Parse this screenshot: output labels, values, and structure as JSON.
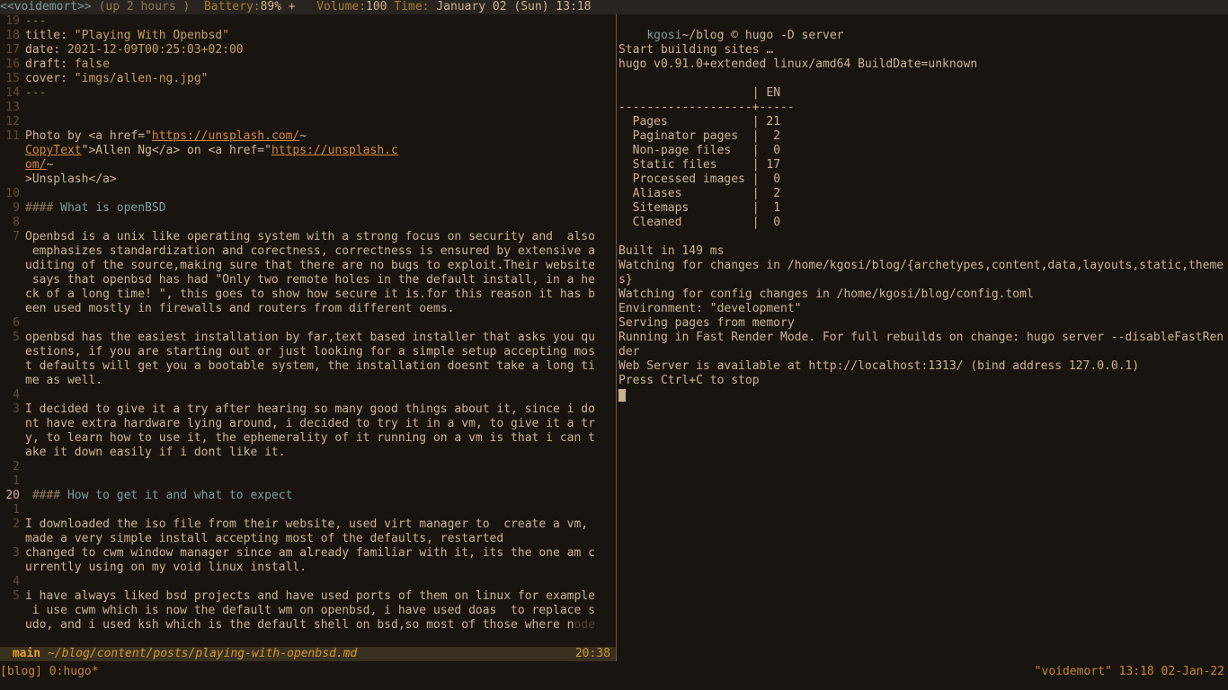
{
  "topbar": {
    "host": "<<voidemort>>",
    "uptime": " (up 2 hours )  ",
    "bat_label": "Battery:",
    "bat_value": "89% +   ",
    "vol_label": "Volume:",
    "vol_value": "100 ",
    "time_label": "Time: ",
    "time_value": "January 02 (Sun) 13:18"
  },
  "editor": {
    "lines": [
      {
        "n": "19",
        "segs": [
          {
            "c": "punct",
            "t": "---"
          }
        ]
      },
      {
        "n": "18",
        "segs": [
          {
            "c": "key",
            "t": "title: "
          },
          {
            "c": "str",
            "t": "\"Playing With Openbsd\""
          }
        ]
      },
      {
        "n": "17",
        "segs": [
          {
            "c": "key",
            "t": "date: "
          },
          {
            "c": "str",
            "t": "2021-12-09T00:25:03+02:00"
          }
        ]
      },
      {
        "n": "16",
        "segs": [
          {
            "c": "key",
            "t": "draft: "
          },
          {
            "c": "str",
            "t": "false"
          }
        ]
      },
      {
        "n": "15",
        "segs": [
          {
            "c": "key",
            "t": "cover: "
          },
          {
            "c": "str",
            "t": "\"imgs/allen-ng.jpg\""
          }
        ]
      },
      {
        "n": "14",
        "segs": [
          {
            "c": "punct",
            "t": "---"
          }
        ]
      },
      {
        "n": "13",
        "segs": [
          {
            "c": "txt",
            "t": ""
          }
        ]
      },
      {
        "n": "12",
        "segs": [
          {
            "c": "txt",
            "t": ""
          }
        ]
      },
      {
        "n": "11",
        "segs": [
          {
            "c": "txt",
            "t": "Photo by <a href=\""
          },
          {
            "c": "link",
            "t": "https://unsplash.com/"
          },
          {
            "c": "txt",
            "t": "~"
          }
        ]
      },
      {
        "n": "",
        "segs": [
          {
            "c": "link",
            "t": "CopyText"
          },
          {
            "c": "txt",
            "t": "\">Allen Ng</a> on <a href=\""
          },
          {
            "c": "link",
            "t": "https://unsplash.c"
          }
        ]
      },
      {
        "n": "",
        "segs": [
          {
            "c": "link",
            "t": "om/"
          },
          {
            "c": "txt",
            "t": "~"
          }
        ]
      },
      {
        "n": "",
        "segs": [
          {
            "c": "txt",
            "t": ">Unsplash</a>"
          }
        ]
      },
      {
        "n": "10",
        "segs": [
          {
            "c": "txt",
            "t": ""
          }
        ]
      },
      {
        "n": "9",
        "segs": [
          {
            "c": "punct",
            "t": "#### "
          },
          {
            "c": "heading",
            "t": "What is openBSD"
          }
        ]
      },
      {
        "n": "8",
        "segs": [
          {
            "c": "txt",
            "t": ""
          }
        ]
      },
      {
        "n": "7",
        "segs": [
          {
            "c": "txt",
            "t": "Openbsd is a unix like operating system with a strong focus on security and  also"
          }
        ]
      },
      {
        "n": "",
        "segs": [
          {
            "c": "txt",
            "t": " emphasizes standardization and corectness, correctness is ensured by extensive a"
          }
        ]
      },
      {
        "n": "",
        "segs": [
          {
            "c": "txt",
            "t": "uditing of the source,making sure that there are no bugs to exploit.Their website"
          }
        ]
      },
      {
        "n": "",
        "segs": [
          {
            "c": "txt",
            "t": " says that openbsd has had \"Only two remote holes in the default install, in a he"
          }
        ]
      },
      {
        "n": "",
        "segs": [
          {
            "c": "txt",
            "t": "ck of a long time! \", this goes to show how secure it is.for this reason it has b"
          }
        ]
      },
      {
        "n": "",
        "segs": [
          {
            "c": "txt",
            "t": "een used mostly in firewalls and routers from different oems."
          }
        ]
      },
      {
        "n": "6",
        "segs": [
          {
            "c": "txt",
            "t": ""
          }
        ]
      },
      {
        "n": "5",
        "segs": [
          {
            "c": "txt",
            "t": "openbsd has the easiest installation by far,text based installer that asks you qu"
          }
        ]
      },
      {
        "n": "",
        "segs": [
          {
            "c": "txt",
            "t": "estions, if you are starting out or just looking for a simple setup accepting mos"
          }
        ]
      },
      {
        "n": "",
        "segs": [
          {
            "c": "txt",
            "t": "t defaults will get you a bootable system, the installation doesnt take a long ti"
          }
        ]
      },
      {
        "n": "",
        "segs": [
          {
            "c": "txt",
            "t": "me as well."
          }
        ]
      },
      {
        "n": "4",
        "segs": [
          {
            "c": "txt",
            "t": ""
          }
        ]
      },
      {
        "n": "3",
        "segs": [
          {
            "c": "txt",
            "t": "I decided to give it a try after hearing so many good things about it, since i do"
          }
        ]
      },
      {
        "n": "",
        "segs": [
          {
            "c": "txt",
            "t": "nt have extra hardware lying around, i decided to try it in a vm, to give it a tr"
          }
        ]
      },
      {
        "n": "",
        "segs": [
          {
            "c": "txt",
            "t": "y, to learn how to use it, the ephemerality of it running on a vm is that i can t"
          }
        ]
      },
      {
        "n": "",
        "segs": [
          {
            "c": "txt",
            "t": "ake it down easily if i dont like it."
          }
        ]
      },
      {
        "n": "2",
        "segs": [
          {
            "c": "txt",
            "t": ""
          }
        ]
      },
      {
        "n": "1",
        "segs": [
          {
            "c": "txt",
            "t": ""
          }
        ]
      },
      {
        "n": "20",
        "segs": [
          {
            "c": "txt",
            "t": " "
          },
          {
            "c": "punct",
            "t": "#### "
          },
          {
            "c": "heading",
            "t": "How to get it and what to expect"
          }
        ],
        "cur": true
      },
      {
        "n": "1",
        "segs": [
          {
            "c": "txt",
            "t": ""
          }
        ]
      },
      {
        "n": "2",
        "segs": [
          {
            "c": "txt",
            "t": "I downloaded the iso file from their website, used virt manager to  create a vm, "
          }
        ]
      },
      {
        "n": "",
        "segs": [
          {
            "c": "txt",
            "t": "made a very simple install accepting most of the defaults, restarted"
          }
        ]
      },
      {
        "n": "3",
        "segs": [
          {
            "c": "txt",
            "t": "changed to cwm window manager since am already familiar with it, its the one am c"
          }
        ]
      },
      {
        "n": "",
        "segs": [
          {
            "c": "txt",
            "t": "urrently using on my void linux install."
          }
        ]
      },
      {
        "n": "4",
        "segs": [
          {
            "c": "txt",
            "t": ""
          }
        ]
      },
      {
        "n": "5",
        "segs": [
          {
            "c": "txt",
            "t": "i have always liked bsd projects and have used ports of them on linux for example"
          }
        ]
      },
      {
        "n": "",
        "segs": [
          {
            "c": "txt",
            "t": " i use cwm which is now the default wm on openbsd, i have used doas  to replace s"
          }
        ]
      },
      {
        "n": "",
        "segs": [
          {
            "c": "txt",
            "t": "udo, and i used ksh which is the default shell on bsd,so most of those where n"
          },
          {
            "c": "ghost",
            "t": "ode"
          }
        ]
      }
    ],
    "status": {
      "mode": " main ",
      "path": "~/blog/content/posts/playing-with-openbsd.md",
      "pos": "20:38"
    }
  },
  "term": {
    "prompt_user": "kgosi",
    "prompt_cwd": "~/blog",
    "prompt_glyph": " © ",
    "cmd": "hugo -D server",
    "lines": [
      "Start building sites …",
      "hugo v0.91.0+extended linux/amd64 BuildDate=unknown",
      "",
      "                   | EN",
      "-------------------+-----",
      "  Pages            | 21",
      "  Paginator pages  |  2",
      "  Non-page files   |  0",
      "  Static files     | 17",
      "  Processed images |  0",
      "  Aliases          |  2",
      "  Sitemaps         |  1",
      "  Cleaned          |  0",
      "",
      "Built in 149 ms",
      "Watching for changes in /home/kgosi/blog/{archetypes,content,data,layouts,static,themes}",
      "Watching for config changes in /home/kgosi/blog/config.toml",
      "Environment: \"development\"",
      "Serving pages from memory",
      "Running in Fast Render Mode. For full rebuilds on change: hugo server --disableFastRender",
      "Web Server is available at http://localhost:1313/ (bind address 127.0.0.1)",
      "Press Ctrl+C to stop"
    ]
  },
  "tmux": {
    "left": "[blog] 0:hugo*",
    "right": "\"voidemort\" 13:18 02-Jan-22"
  }
}
